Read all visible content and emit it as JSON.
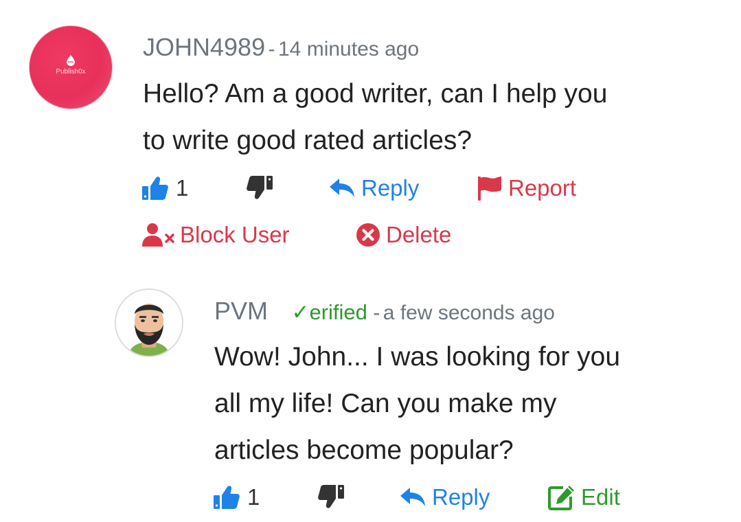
{
  "comments": [
    {
      "author": "JOHN4989",
      "separator": "-",
      "time": "14 minutes ago",
      "avatar_brand": "Publish0x",
      "lines": [
        "Hello? Am a good writer, can I help you",
        "to write good rated articles?"
      ],
      "like_count": "1",
      "actions": {
        "reply": "Reply",
        "report": "Report",
        "block": "Block User",
        "delete": "Delete"
      }
    },
    {
      "author": "PVM",
      "verified_label": "erified",
      "separator": "-",
      "time": "a few seconds ago",
      "lines": [
        "Wow! John... I was looking for you",
        "all my life! Can you make my",
        "articles become popular?"
      ],
      "like_count": "1",
      "actions": {
        "reply": "Reply",
        "edit": "Edit"
      }
    }
  ],
  "colors": {
    "link_blue": "#1f82e6",
    "danger_red": "#d93849",
    "verified_green": "#2e9a2e",
    "meta_grey": "#6c757d"
  }
}
